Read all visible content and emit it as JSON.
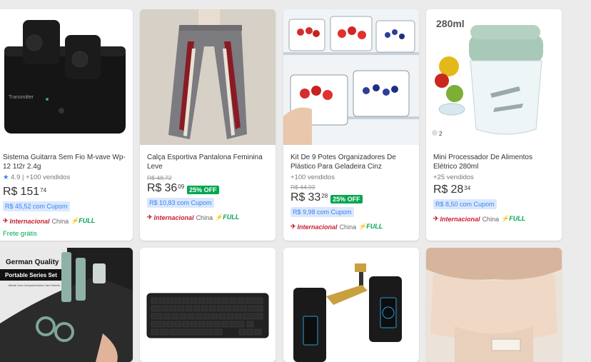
{
  "products": [
    {
      "title": "Sistema Guitarra Sem Fio M-vave Wp-12 1t2r 2.4g",
      "rating": "4.9",
      "sold": "| +100 vendidos",
      "price": "R$",
      "price_int": "151",
      "price_cents": "74",
      "coupon": "R$ 45,52 com Cupom",
      "intl": "Internacional",
      "origin": "China",
      "full": "FULL",
      "shipping": "Frete grátis",
      "image_text": "Transmitter"
    },
    {
      "title": "Calça Esportiva Pantalona Feminina Leve",
      "old_price": "R$ 48,72",
      "price": "R$",
      "price_int": "36",
      "price_cents": "09",
      "discount": "25% OFF",
      "coupon": "R$ 10,83 com Cupom",
      "intl": "Internacional",
      "origin": "China",
      "full": "FULL"
    },
    {
      "title": "Kit De 9 Potes Organizadores De Plástico Para Geladeira Cinz",
      "sold": "+100 vendidos",
      "old_price": "R$ 44,93",
      "price": "R$",
      "price_int": "33",
      "price_cents": "28",
      "discount": "25% OFF",
      "coupon": "R$ 9,98 com Cupom",
      "intl": "Internacional",
      "origin": "China",
      "full": "FULL"
    },
    {
      "title": "Mini Processador De Alimentos Elétrico 280ml",
      "sold": "+25 vendidos",
      "price": "R$",
      "price_int": "28",
      "price_cents": "34",
      "coupon": "R$ 8,50 com Cupom",
      "intl": "Internacional",
      "origin": "China",
      "full": "FULL",
      "image_text": "280ml",
      "image_badge": "2"
    },
    {
      "image_text_top": "German Quality",
      "image_text_sub": "Portable Series Set",
      "image_text_small": "Meets Your Comprehensive Care Needs"
    },
    {},
    {},
    {}
  ]
}
